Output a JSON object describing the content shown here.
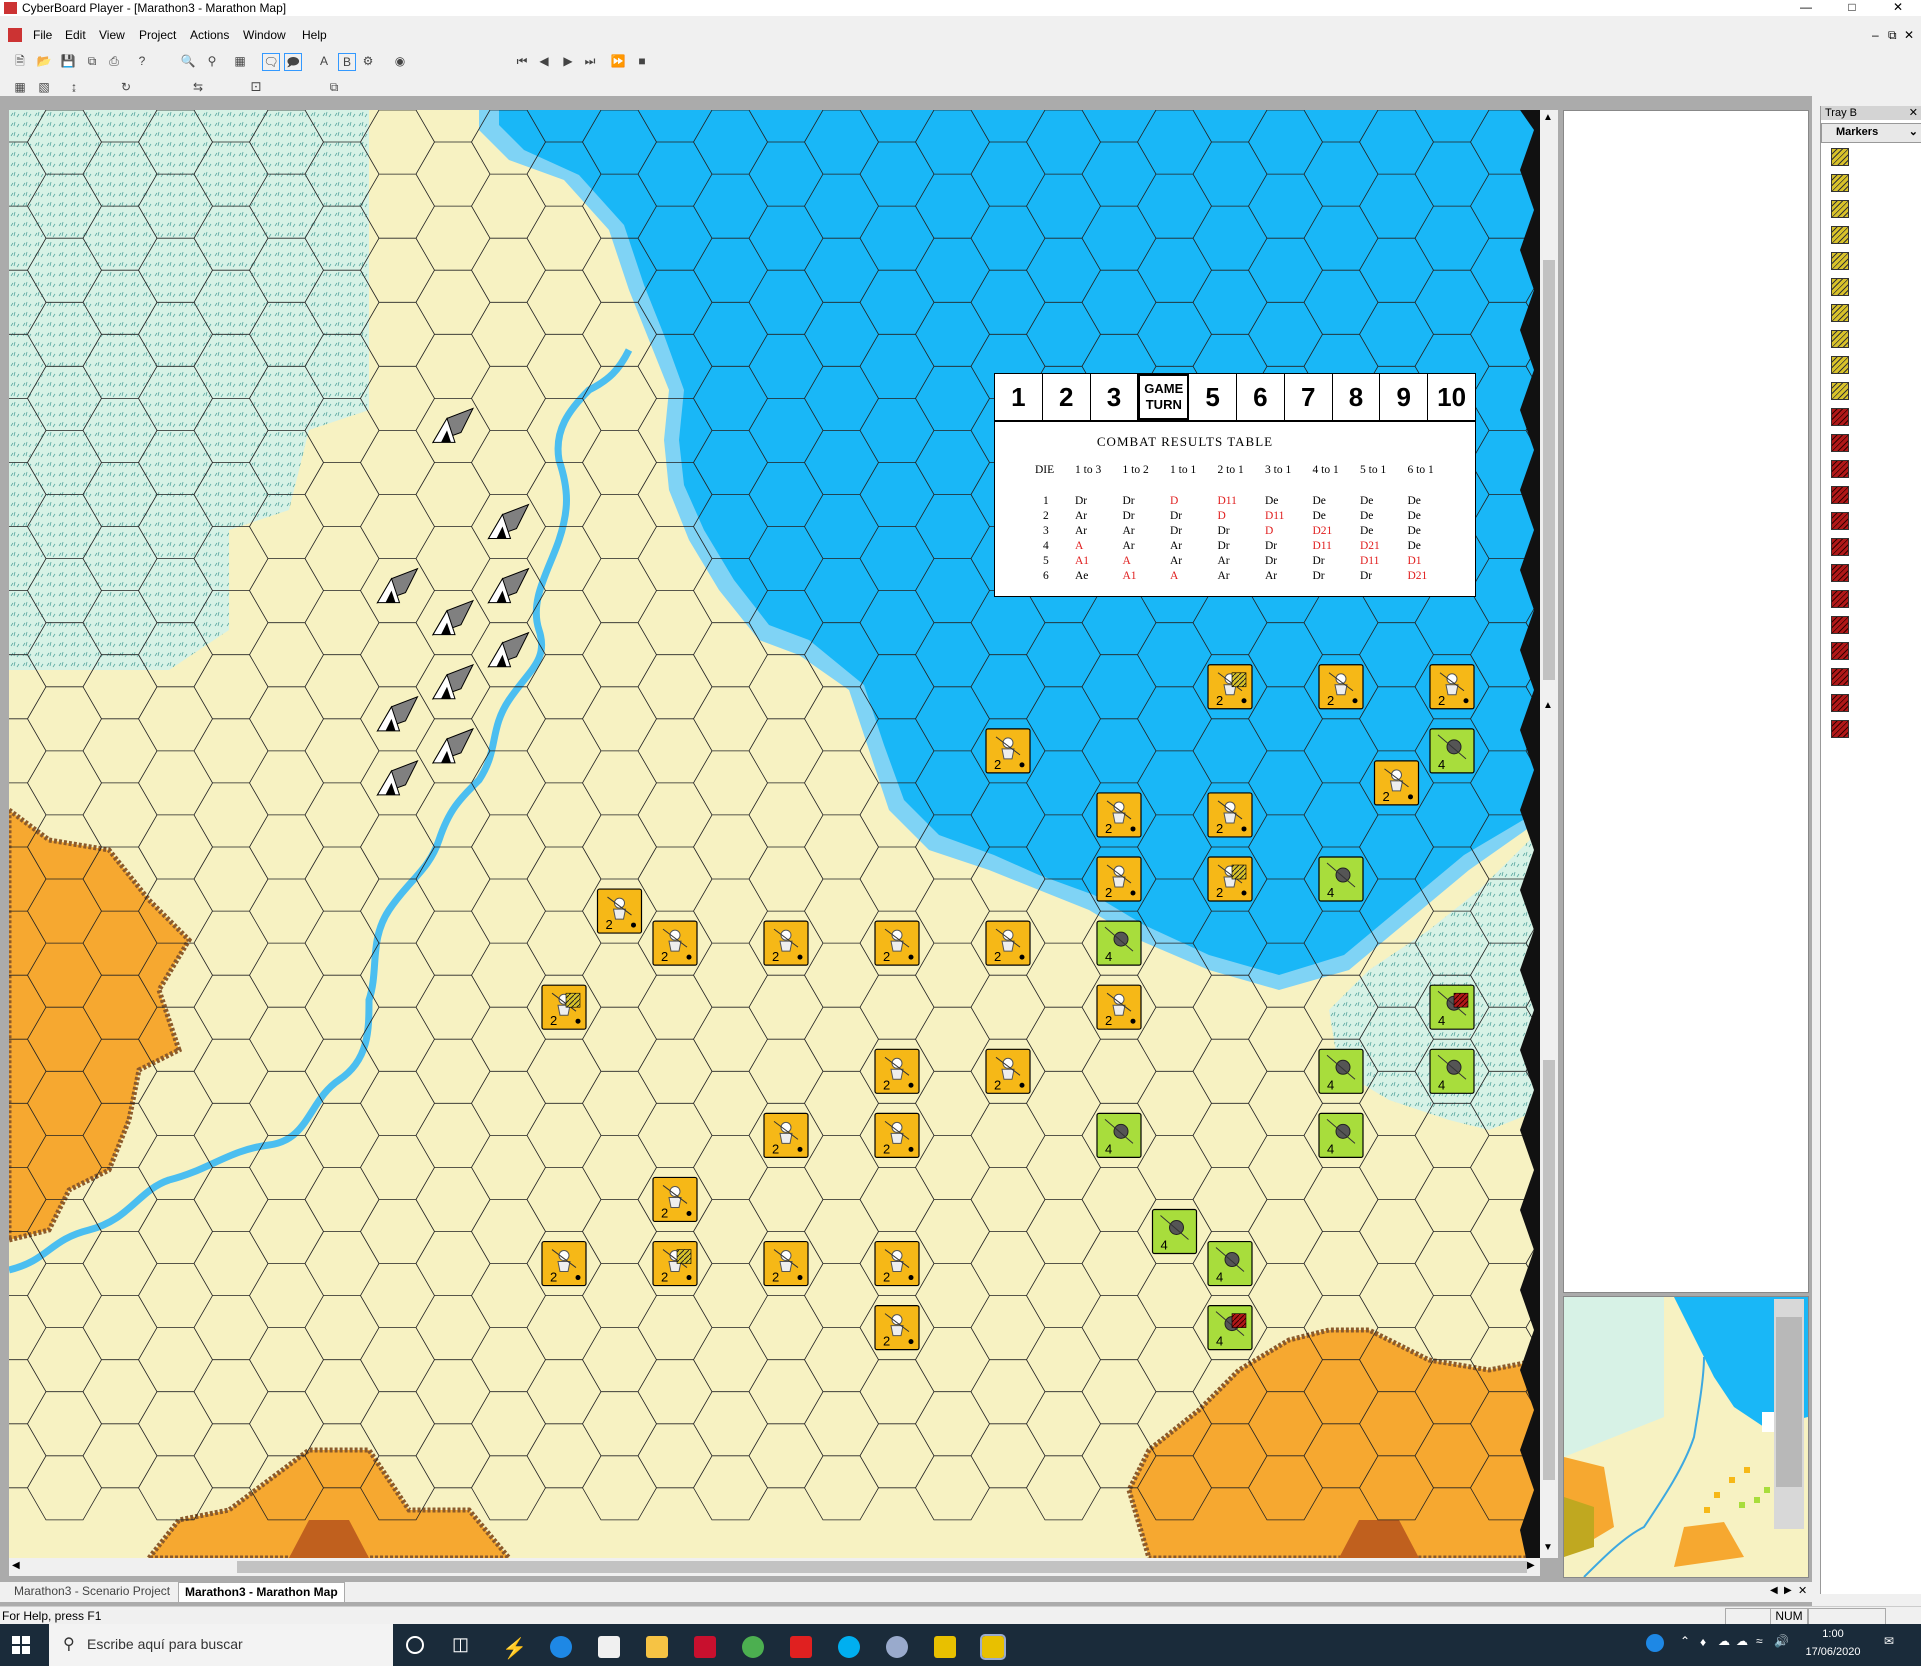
{
  "window": {
    "title": "CyberBoard Player - [Marathon3 - Marathon Map]"
  },
  "menu": [
    "File",
    "Edit",
    "View",
    "Project",
    "Actions",
    "Window",
    "Help"
  ],
  "track": {
    "cells": [
      "1",
      "2",
      "3",
      "GAME TURN",
      "5",
      "6",
      "7",
      "8",
      "9",
      "10"
    ],
    "game_turn_label_top": "GAME",
    "game_turn_label_bottom": "TURN"
  },
  "crt": {
    "title": "COMBAT RESULTS TABLE",
    "columns": [
      "DIE",
      "1 to 3",
      "1 to 2",
      "1 to 1",
      "2 to 1",
      "3 to 1",
      "4 to 1",
      "5 to 1",
      "6 to 1"
    ],
    "rows": [
      [
        "1",
        "Dr",
        "Dr",
        "D",
        "D11",
        "De",
        "De",
        "De",
        "De"
      ],
      [
        "2",
        "Ar",
        "Dr",
        "Dr",
        "D",
        "D11",
        "De",
        "De",
        "De"
      ],
      [
        "3",
        "Ar",
        "Ar",
        "Dr",
        "Dr",
        "D",
        "D21",
        "De",
        "De"
      ],
      [
        "4",
        "A",
        "Ar",
        "Ar",
        "Dr",
        "Dr",
        "D11",
        "D21",
        "De"
      ],
      [
        "5",
        "A1",
        "A",
        "Ar",
        "Ar",
        "Dr",
        "Dr",
        "D11",
        "D1"
      ],
      [
        "6",
        "Ae",
        "A1",
        "A",
        "Ar",
        "Ar",
        "Dr",
        "Dr",
        "D21"
      ]
    ],
    "red_cells": [
      "D",
      "D11",
      "D21",
      "A",
      "A1",
      "D1"
    ]
  },
  "tray": {
    "header": "Tray B",
    "selection": "Markers",
    "yellow_count": 10,
    "red_count": 13
  },
  "tabs": [
    "Marathon3 - Scenario Project",
    "Marathon3 - Marathon Map"
  ],
  "status": {
    "help": "For Help, press F1",
    "num": "NUM"
  },
  "taskbar": {
    "search_placeholder": "Escribe aquí para buscar",
    "time": "1:00",
    "date": "17/06/2020"
  },
  "units": {
    "persian": [
      {
        "col": 34,
        "row": 6,
        "v": "2"
      },
      {
        "col": 33,
        "row": 7,
        "v": "2"
      },
      {
        "col": 35,
        "row": 7,
        "v": "2"
      },
      {
        "col": 29,
        "row": 7,
        "v": "2"
      },
      {
        "col": 31,
        "row": 7,
        "v": "2"
      },
      {
        "col": 28,
        "row": 8,
        "v": "2"
      },
      {
        "col": 30,
        "row": 8,
        "v": "2"
      },
      {
        "col": 32,
        "row": 8,
        "v": "2"
      },
      {
        "col": 26,
        "row": 9,
        "v": "2"
      },
      {
        "col": 24,
        "row": 9,
        "v": "2"
      },
      {
        "col": 22,
        "row": 9,
        "v": "2"
      },
      {
        "col": 25,
        "row": 10,
        "v": "2"
      },
      {
        "col": 28,
        "row": 10,
        "v": "2"
      },
      {
        "col": 18,
        "row": 10,
        "v": "2"
      },
      {
        "col": 20,
        "row": 11,
        "v": "2"
      },
      {
        "col": 22,
        "row": 11,
        "v": "2"
      },
      {
        "col": 20,
        "row": 12,
        "v": "2"
      },
      {
        "col": 22,
        "row": 12,
        "v": "2"
      },
      {
        "col": 11,
        "row": 12,
        "v": "2"
      },
      {
        "col": 14,
        "row": 13,
        "v": "2"
      },
      {
        "col": 12,
        "row": 13,
        "v": "2"
      },
      {
        "col": 16,
        "row": 13,
        "v": "2"
      },
      {
        "col": 18,
        "row": 13,
        "v": "2"
      },
      {
        "col": 20,
        "row": 14,
        "v": "2"
      },
      {
        "col": 10,
        "row": 14,
        "v": "2"
      },
      {
        "col": 16,
        "row": 15,
        "v": "2"
      },
      {
        "col": 18,
        "row": 15,
        "v": "2"
      },
      {
        "col": 14,
        "row": 16,
        "v": "2"
      },
      {
        "col": 12,
        "row": 17,
        "v": "2"
      },
      {
        "col": 16,
        "row": 16,
        "v": "2"
      },
      {
        "col": 10,
        "row": 18,
        "v": "2"
      },
      {
        "col": 12,
        "row": 18,
        "v": "2"
      },
      {
        "col": 14,
        "row": 18,
        "v": "2"
      },
      {
        "col": 16,
        "row": 18,
        "v": "2"
      },
      {
        "col": 16,
        "row": 19,
        "v": "2"
      }
    ],
    "greek": [
      {
        "col": 37,
        "row": 8,
        "v": "4"
      },
      {
        "col": 36,
        "row": 9,
        "v": "4"
      },
      {
        "col": 38,
        "row": 9,
        "v": "4"
      },
      {
        "col": 40,
        "row": 10,
        "v": "4"
      },
      {
        "col": 32,
        "row": 10,
        "v": "4"
      },
      {
        "col": 34,
        "row": 10,
        "v": "4"
      },
      {
        "col": 36,
        "row": 10,
        "v": "4"
      },
      {
        "col": 26,
        "row": 10,
        "v": "4"
      },
      {
        "col": 30,
        "row": 11,
        "v": "4"
      },
      {
        "col": 28,
        "row": 11,
        "v": "4"
      },
      {
        "col": 32,
        "row": 11,
        "v": "4"
      },
      {
        "col": 34,
        "row": 12,
        "v": "4"
      },
      {
        "col": 36,
        "row": 11,
        "v": "4"
      },
      {
        "col": 38,
        "row": 11,
        "v": "4"
      },
      {
        "col": 24,
        "row": 12,
        "v": "4"
      },
      {
        "col": 28,
        "row": 12,
        "v": "4"
      },
      {
        "col": 20,
        "row": 13,
        "v": "4"
      },
      {
        "col": 26,
        "row": 14,
        "v": "4"
      },
      {
        "col": 24,
        "row": 15,
        "v": "4"
      },
      {
        "col": 26,
        "row": 15,
        "v": "4"
      },
      {
        "col": 24,
        "row": 16,
        "v": "4"
      },
      {
        "col": 20,
        "row": 16,
        "v": "4"
      },
      {
        "col": 21,
        "row": 17,
        "v": "4"
      },
      {
        "col": 22,
        "row": 18,
        "v": "4"
      },
      {
        "col": 22,
        "row": 19,
        "v": "4"
      }
    ]
  },
  "colors": {
    "sea": "#19b7f7",
    "plain": "#f7f2c2",
    "marsh": "#d7f2e6",
    "hill": "#f6a830",
    "river": "#4bbef0",
    "persian": "#f6b817",
    "greek": "#a8dd3c"
  }
}
